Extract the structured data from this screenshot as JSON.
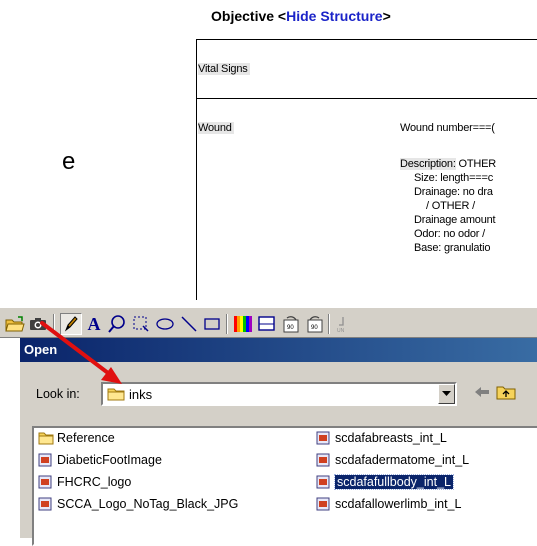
{
  "document": {
    "heading_prefix": "Objective <",
    "heading_link": "Hide Structure",
    "heading_suffix": ">",
    "side_text": "e",
    "rows": {
      "vital_signs": "Vital Signs",
      "wound": "Wound",
      "wound_number": "Wound number===(",
      "description_label": "Description:",
      "description_value": " OTHER",
      "size": "Size: length===c",
      "drainage": "Drainage: no dra",
      "other_line": "/ OTHER /",
      "drainage_amount": "Drainage amount",
      "odor": "Odor: no odor /",
      "base": "Base: granulatio"
    }
  },
  "toolbar": {
    "icons": [
      "open-folder-icon",
      "camera-icon",
      "pencil-icon",
      "text-icon",
      "zoom-icon",
      "crop-icon",
      "ellipse-icon",
      "line-icon",
      "rectangle-icon",
      "color-palette-icon",
      "frame-icon",
      "rotate-left-icon",
      "rotate-right-icon",
      "undo-icon"
    ],
    "text_tool_glyph": "A"
  },
  "dialog": {
    "title": "Open",
    "look_in_label": "Look in:",
    "look_in_value": "inks",
    "files_left": [
      {
        "name": "Reference",
        "type": "folder"
      },
      {
        "name": "DiabeticFootImage",
        "type": "file"
      },
      {
        "name": "FHCRC_logo",
        "type": "file"
      },
      {
        "name": "SCCA_Logo_NoTag_Black_JPG",
        "type": "file"
      }
    ],
    "files_right": [
      {
        "name": "scdafabreasts_int_L",
        "type": "file",
        "selected": false
      },
      {
        "name": "scdafadermatome_int_L",
        "type": "file",
        "selected": false
      },
      {
        "name": "scdafafullbody_int_L",
        "type": "file",
        "selected": true
      },
      {
        "name": "scdafallowerlimb_int_L",
        "type": "file",
        "selected": false
      }
    ]
  },
  "colors": {
    "titlebar_start": "#0a246a",
    "titlebar_end": "#3a6ea5",
    "dialog_face": "#d4d0c8",
    "selection": "#0a246a",
    "link": "#1a23c8",
    "arrow": "#e01010"
  }
}
